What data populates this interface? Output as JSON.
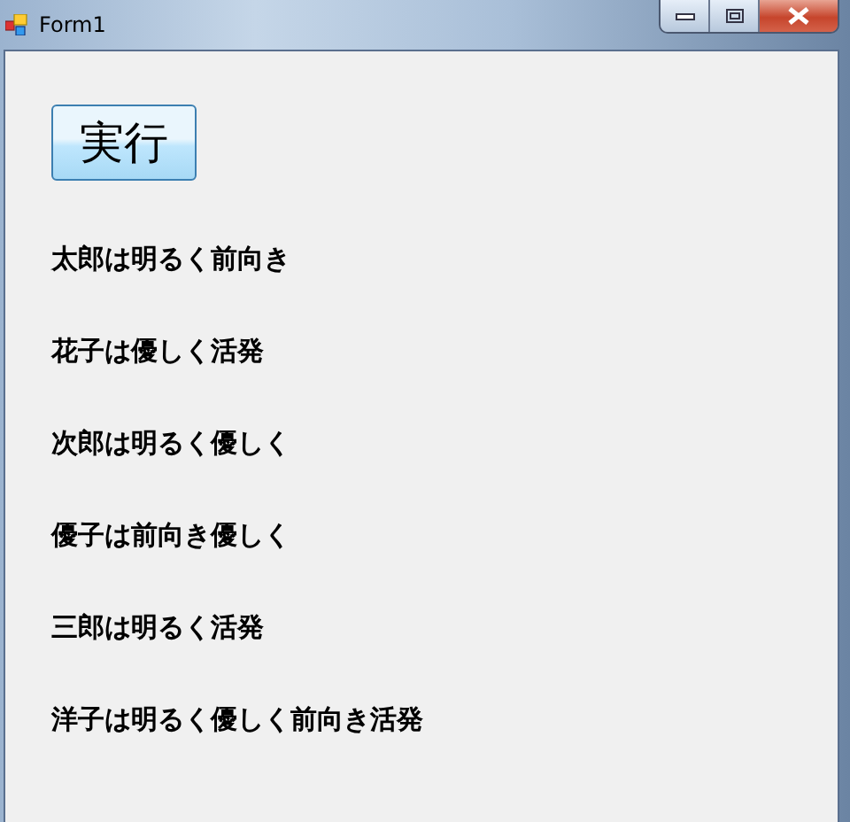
{
  "window": {
    "title": "Form1"
  },
  "button": {
    "label": "実行"
  },
  "labels": [
    "太郎は明るく前向き",
    "花子は優しく活発",
    "次郎は明るく優しく",
    "優子は前向き優しく",
    "三郎は明るく活発",
    "洋子は明るく優しく前向き活発"
  ]
}
